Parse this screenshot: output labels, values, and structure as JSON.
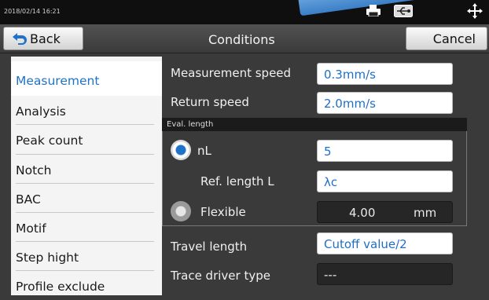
{
  "status_bar": {
    "datetime": "2018/02/14 16:21",
    "icons": [
      "printer-icon",
      "usb-icon",
      "move-icon"
    ]
  },
  "title_bar": {
    "back_label": "Back",
    "title": "Conditions",
    "cancel_label": "Cancel"
  },
  "sidebar": {
    "selected": "Measurement",
    "items": [
      {
        "label": "Measurement"
      },
      {
        "label": "Analysis"
      },
      {
        "label": "Peak count"
      },
      {
        "label": "Notch"
      },
      {
        "label": "BAC"
      },
      {
        "label": "Motif"
      },
      {
        "label": "Step hight"
      },
      {
        "label": "Profile exclude"
      }
    ]
  },
  "conditions": {
    "measurement_speed_label": "Measurement speed",
    "measurement_speed_value": "0.3mm/s",
    "return_speed_label": "Return speed",
    "return_speed_value": "2.0mm/s",
    "eval_length": {
      "header": "Eval. length",
      "nl_label": "nL",
      "nl_value": "5",
      "nl_selected": true,
      "ref_length_label": "Ref. length L",
      "ref_length_value": "λc",
      "flexible_label": "Flexible",
      "flexible_value": "4.00",
      "flexible_unit": "mm",
      "flexible_selected": false
    },
    "travel_length_label": "Travel length",
    "travel_length_value": "Cutoff value/2",
    "trace_driver_label": "Trace driver type",
    "trace_driver_value": "---"
  },
  "colors": {
    "accent": "#1e73c9",
    "background": "#3a3a3a",
    "status_bar": "#0f0f0f",
    "sidebar": "#f4f4f4"
  }
}
